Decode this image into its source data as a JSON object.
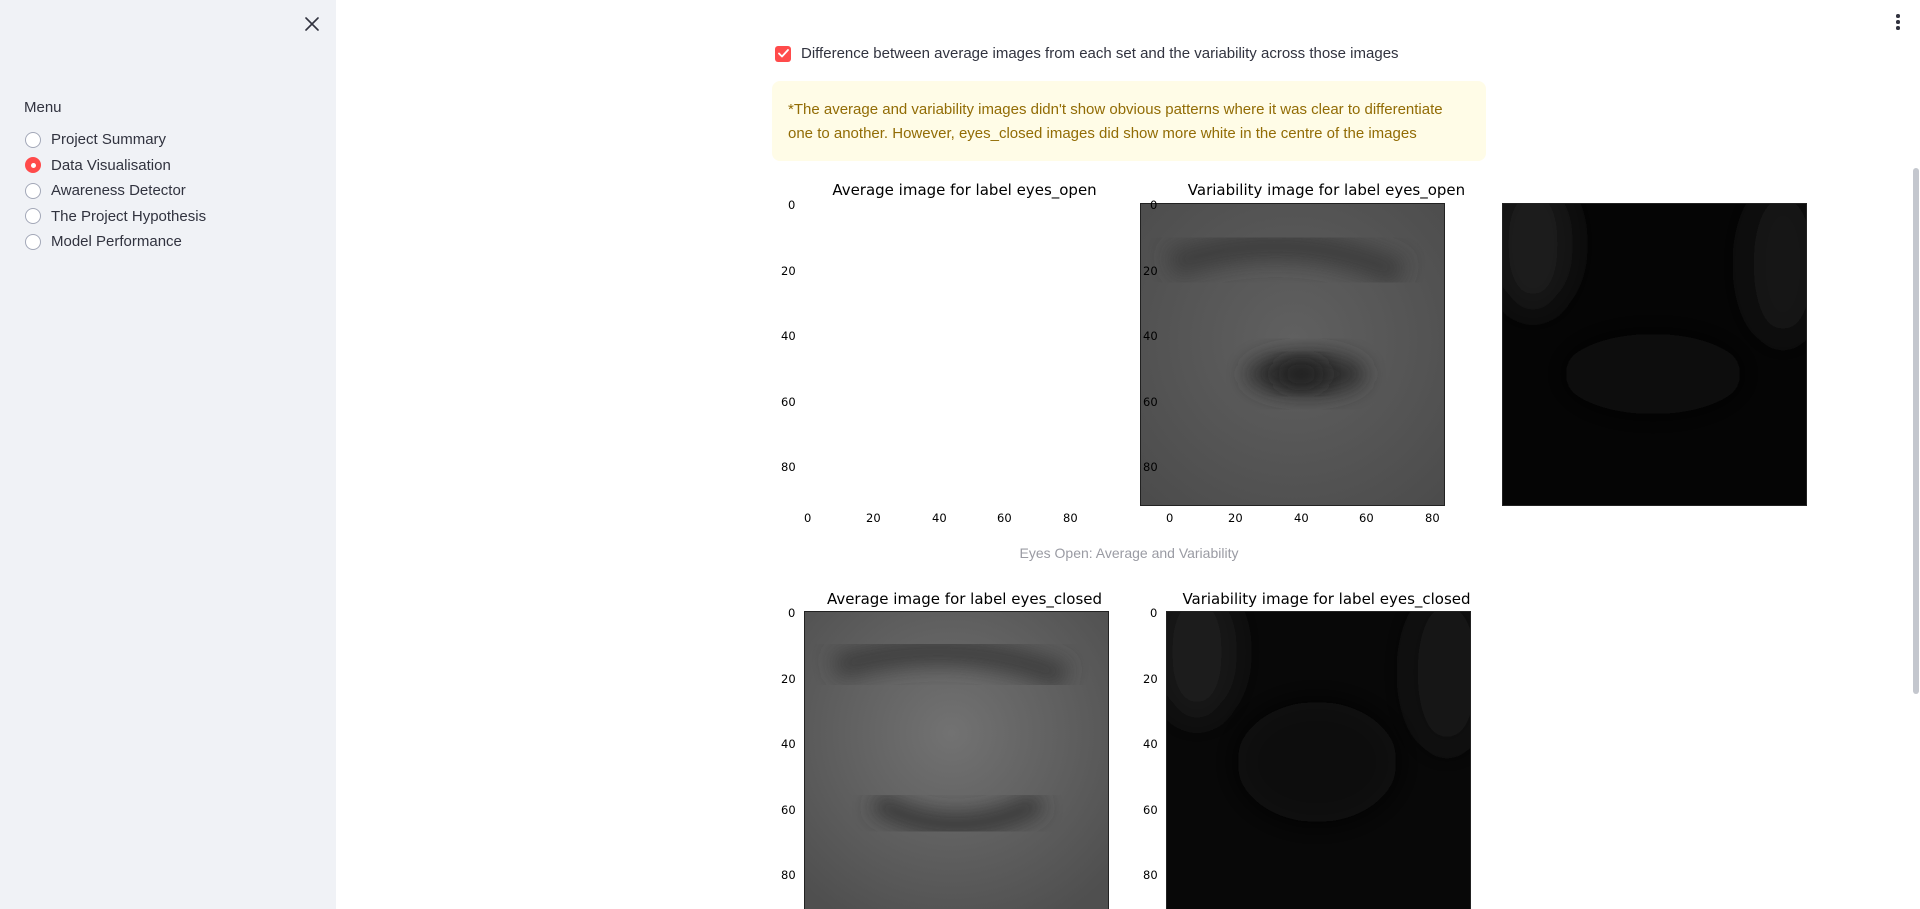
{
  "sidebar": {
    "menu_label": "Menu",
    "items": [
      {
        "label": "Project Summary",
        "selected": false
      },
      {
        "label": "Data Visualisation",
        "selected": true
      },
      {
        "label": "Awareness Detector",
        "selected": false
      },
      {
        "label": "The Project Hypothesis",
        "selected": false
      },
      {
        "label": "Model Performance",
        "selected": false
      }
    ]
  },
  "main": {
    "checkbox_label": "Difference between average images from each set and the variability across those images",
    "checkbox_checked": true,
    "warning_text": "*The average and variability images didn't show obvious patterns where it was clear to differentiate one to another. However, eyes_closed images did show more white in the centre of the images",
    "figures": [
      {
        "avg_title": "Average image for label eyes_open",
        "var_title": "Variability image for label eyes_open",
        "caption": "Eyes Open: Average and Variability"
      },
      {
        "avg_title": "Average image for label eyes_closed",
        "var_title": "Variability image for label eyes_closed",
        "caption": ""
      }
    ],
    "y_ticks": [
      "0",
      "20",
      "40",
      "60",
      "80"
    ],
    "x_ticks": [
      "0",
      "20",
      "40",
      "60",
      "80"
    ]
  },
  "colors": {
    "accent": "#ff4b4b",
    "sidebar_bg": "#f0f2f6",
    "warning_bg": "#fffce7",
    "warning_text": "#926c05"
  },
  "icons": {
    "close": "close-icon",
    "menu": "kebab-menu-icon",
    "check": "check-icon"
  }
}
